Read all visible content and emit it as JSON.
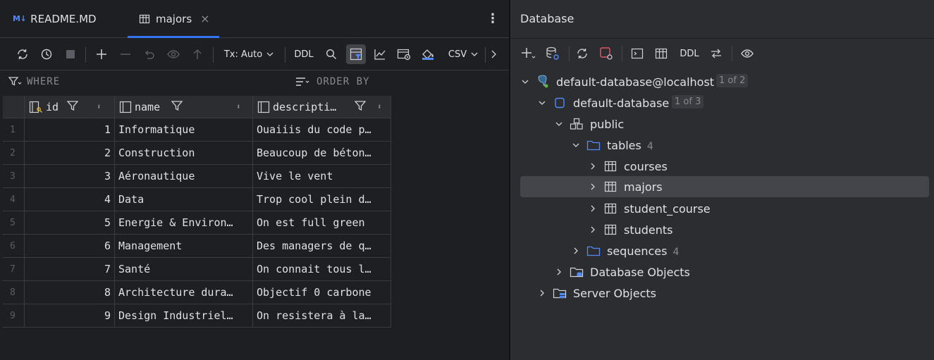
{
  "editor": {
    "tabs": [
      {
        "label": "README.MD",
        "badge": "M↓"
      },
      {
        "label": "majors"
      }
    ],
    "toolbar": {
      "tx_label": "Tx: Auto",
      "ddl_label": "DDL",
      "export_label": "CSV"
    },
    "filter": {
      "where_label": "WHERE",
      "order_label": "ORDER BY"
    },
    "grid": {
      "columns": [
        "id",
        "name",
        "descripti…"
      ],
      "rows": [
        {
          "n": "1",
          "id": "1",
          "name": "Informatique",
          "desc": "Ouaiiis du code p…"
        },
        {
          "n": "2",
          "id": "2",
          "name": "Construction",
          "desc": "Beaucoup de béton…"
        },
        {
          "n": "3",
          "id": "3",
          "name": "Aéronautique",
          "desc": "Vive le vent"
        },
        {
          "n": "4",
          "id": "4",
          "name": "Data",
          "desc": "Trop cool plein d…"
        },
        {
          "n": "5",
          "id": "5",
          "name": "Energie & Environ…",
          "desc": "On est full green"
        },
        {
          "n": "6",
          "id": "6",
          "name": "Management",
          "desc": "Des managers de q…"
        },
        {
          "n": "7",
          "id": "7",
          "name": "Santé",
          "desc": "On connait tous l…"
        },
        {
          "n": "8",
          "id": "8",
          "name": "Architecture dura…",
          "desc": "Objectif 0 carbone"
        },
        {
          "n": "9",
          "id": "9",
          "name": "Design Industriel…",
          "desc": "On resistera à la…"
        }
      ]
    }
  },
  "database": {
    "title": "Database",
    "toolbar": {
      "ddl_label": "DDL"
    },
    "tree": {
      "connection": {
        "label": "default-database@localhost",
        "pill": "1 of 2"
      },
      "database": {
        "label": "default-database",
        "pill": "1 of 3"
      },
      "schema": {
        "label": "public"
      },
      "tables": {
        "label": "tables",
        "count": "4"
      },
      "table_items": [
        "courses",
        "majors",
        "student_course",
        "students"
      ],
      "sequences": {
        "label": "sequences",
        "count": "4"
      },
      "db_objects": {
        "label": "Database Objects"
      },
      "server_objects": {
        "label": "Server Objects"
      }
    }
  },
  "colors": {
    "accent": "#3574f0",
    "selection": "#43454a",
    "panel": "#2b2d30",
    "editor": "#1e1f22"
  }
}
